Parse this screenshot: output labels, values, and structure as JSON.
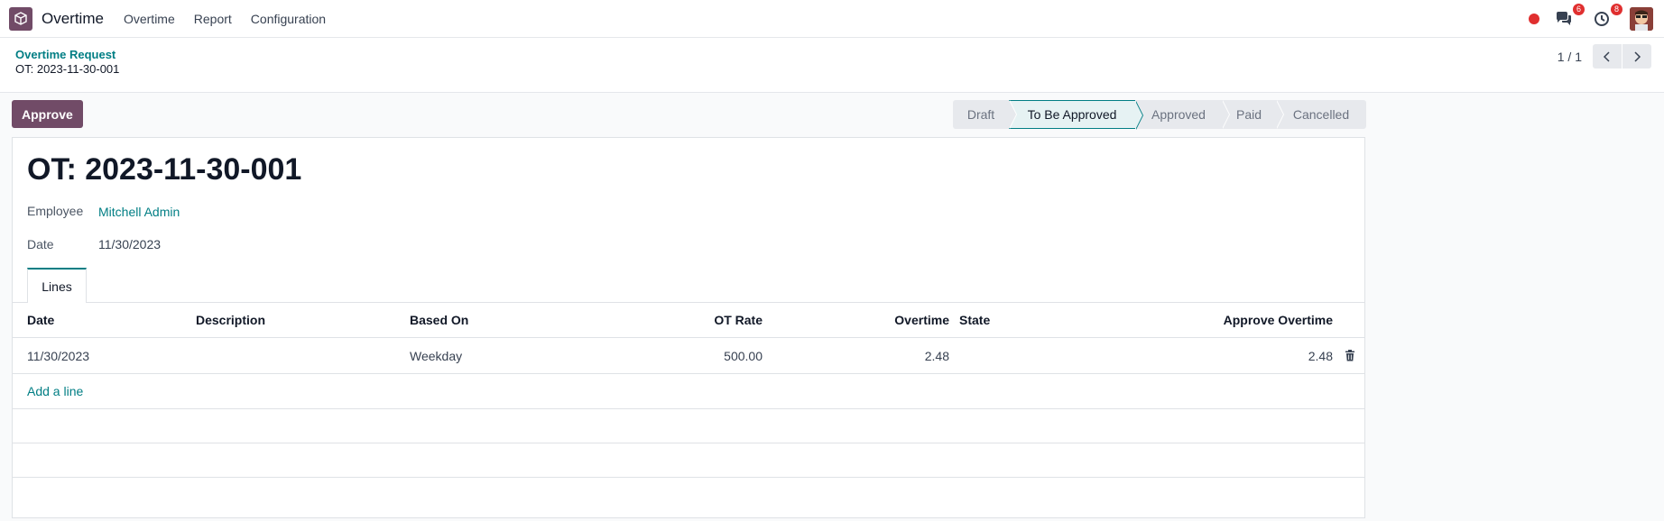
{
  "navbar": {
    "brand": "Overtime",
    "menu": [
      "Overtime",
      "Report",
      "Configuration"
    ],
    "messages_count": "6",
    "activities_count": "8"
  },
  "breadcrumb": {
    "parent": "Overtime Request",
    "current": "OT: 2023-11-30-001"
  },
  "pager": {
    "value": "1 / 1"
  },
  "actions": {
    "approve_label": "Approve"
  },
  "statusbar": {
    "steps": [
      "Draft",
      "To Be Approved",
      "Approved",
      "Paid",
      "Cancelled"
    ],
    "active": "To Be Approved"
  },
  "record": {
    "title": "OT: 2023-11-30-001",
    "employee_label": "Employee",
    "employee_value": "Mitchell Admin",
    "date_label": "Date",
    "date_value": "11/30/2023"
  },
  "tabs": [
    "Lines"
  ],
  "lines": {
    "columns": [
      "Date",
      "Description",
      "Based On",
      "OT Rate",
      "Overtime",
      "State",
      "Approve Overtime"
    ],
    "rows": [
      {
        "date": "11/30/2023",
        "description": "",
        "based_on": "Weekday",
        "ot_rate": "500.00",
        "overtime": "2.48",
        "state": "",
        "approve_overtime": "2.48"
      }
    ],
    "add_line": "Add a line"
  },
  "colors": {
    "brand": "#714b67",
    "link": "#017e84",
    "badge": "#e02f2f"
  }
}
